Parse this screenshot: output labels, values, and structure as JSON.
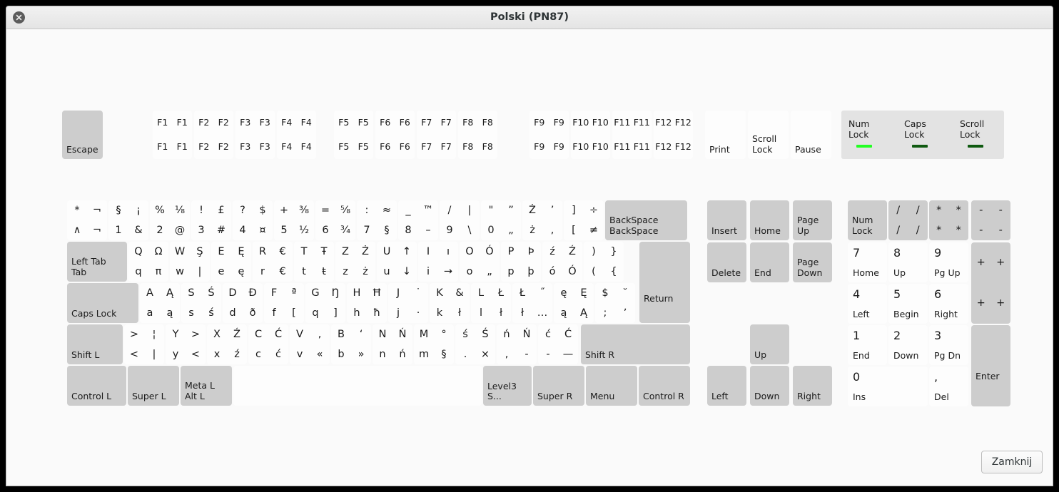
{
  "window": {
    "title": "Polski (PN87)",
    "close_icon": "close-icon"
  },
  "footer": {
    "close_label": "Zamknij"
  },
  "leds": {
    "items": [
      {
        "label": "Num\nLock",
        "line1": "Num",
        "line2": "Lock",
        "color": "#22ff22",
        "state": "on"
      },
      {
        "label": "Caps\nLock",
        "line1": "Caps",
        "line2": "Lock",
        "color": "#0f5a10",
        "state": "off"
      },
      {
        "label": "Scroll\nLock",
        "line1": "Scroll",
        "line2": "Lock",
        "color": "#0f5a10",
        "state": "off"
      }
    ]
  },
  "keys": {
    "escape": {
      "label": "Escape"
    },
    "function_row": [
      {
        "name": "F1",
        "q": [
          "F1",
          "F1",
          "F1",
          "F1"
        ]
      },
      {
        "name": "F2",
        "q": [
          "F2",
          "F2",
          "F2",
          "F2"
        ]
      },
      {
        "name": "F3",
        "q": [
          "F3",
          "F3",
          "F3",
          "F3"
        ]
      },
      {
        "name": "F4",
        "q": [
          "F4",
          "F4",
          "F4",
          "F4"
        ]
      },
      {
        "name": "F5",
        "q": [
          "F5",
          "F5",
          "F5",
          "F5"
        ]
      },
      {
        "name": "F6",
        "q": [
          "F6",
          "F6",
          "F6",
          "F6"
        ]
      },
      {
        "name": "F7",
        "q": [
          "F7",
          "F7",
          "F7",
          "F7"
        ]
      },
      {
        "name": "F8",
        "q": [
          "F8",
          "F8",
          "F8",
          "F8"
        ]
      },
      {
        "name": "F9",
        "q": [
          "F9",
          "F9",
          "F9",
          "F9"
        ]
      },
      {
        "name": "F10",
        "q": [
          "F10",
          "F10",
          "F10",
          "F10"
        ]
      },
      {
        "name": "F11",
        "q": [
          "F11",
          "F11",
          "F11",
          "F11"
        ]
      },
      {
        "name": "F12",
        "q": [
          "F12",
          "F12",
          "F12",
          "F12"
        ]
      }
    ],
    "sysreq": [
      {
        "name": "Print",
        "label": "Print"
      },
      {
        "name": "Scroll Lock",
        "line1": "Scroll",
        "line2": "Lock"
      },
      {
        "name": "Pause",
        "label": "Pause"
      }
    ],
    "row_number": [
      {
        "name": "grave",
        "q": [
          "*",
          "¬",
          "∧",
          "¬"
        ]
      },
      {
        "name": "1",
        "q": [
          "§",
          "¡",
          "1",
          "&"
        ]
      },
      {
        "name": "2",
        "q": [
          "%",
          "⅛",
          "2",
          "@"
        ]
      },
      {
        "name": "3",
        "q": [
          "!",
          "£",
          "3",
          "#"
        ]
      },
      {
        "name": "4",
        "q": [
          "?",
          "$",
          "4",
          "¤"
        ]
      },
      {
        "name": "5",
        "q": [
          "+",
          "⅜",
          "5",
          "½"
        ]
      },
      {
        "name": "6",
        "q": [
          "=",
          "⅝",
          "6",
          "¾"
        ]
      },
      {
        "name": "7",
        "q": [
          ":",
          "≈",
          "7",
          "§"
        ]
      },
      {
        "name": "8",
        "q": [
          "_",
          "™",
          "8",
          "–"
        ]
      },
      {
        "name": "9",
        "q": [
          "/",
          "|",
          "9",
          "\\"
        ]
      },
      {
        "name": "0",
        "q": [
          "\"",
          "”",
          "0",
          "„"
        ]
      },
      {
        "name": "minus",
        "q": [
          "Ż",
          "’",
          "ż",
          ","
        ]
      },
      {
        "name": "equal",
        "q": [
          "]",
          "÷",
          "[",
          "≠"
        ]
      }
    ],
    "backspace": {
      "line1": "BackSpace",
      "line2": "BackSpace"
    },
    "row_q": [
      {
        "name": "Tab",
        "line1": "Left Tab",
        "line2": "Tab"
      },
      {
        "name": "Q",
        "q": [
          "Q",
          "Ω",
          "q",
          "π"
        ]
      },
      {
        "name": "W",
        "q": [
          "W",
          "Ş",
          "w",
          "|"
        ]
      },
      {
        "name": "E",
        "q": [
          "E",
          "Ę",
          "e",
          "ę"
        ]
      },
      {
        "name": "R",
        "q": [
          "R",
          "€",
          "r",
          "€"
        ]
      },
      {
        "name": "T",
        "q": [
          "T",
          "Ŧ",
          "t",
          "ŧ"
        ]
      },
      {
        "name": "Z",
        "q": [
          "Z",
          "Ż",
          "z",
          "ż"
        ]
      },
      {
        "name": "U",
        "q": [
          "U",
          "↑",
          "u",
          "↓"
        ]
      },
      {
        "name": "I",
        "q": [
          "I",
          "ı",
          "i",
          "→"
        ]
      },
      {
        "name": "O",
        "q": [
          "O",
          "Ó",
          "o",
          "„"
        ]
      },
      {
        "name": "P",
        "q": [
          "P",
          "Þ",
          "p",
          "þ"
        ]
      },
      {
        "name": "bracketleft",
        "q": [
          "ź",
          "Ź",
          "ó",
          "Ó"
        ]
      },
      {
        "name": "bracketright",
        "q": [
          ")",
          "}",
          "(",
          "{"
        ]
      }
    ],
    "return": {
      "label": "Return"
    },
    "row_a": [
      {
        "name": "Caps Lock",
        "label": "Caps Lock"
      },
      {
        "name": "A",
        "q": [
          "A",
          "Ą",
          "a",
          "ą"
        ]
      },
      {
        "name": "S",
        "q": [
          "S",
          "Ś",
          "s",
          "ś"
        ]
      },
      {
        "name": "D",
        "q": [
          "D",
          "Đ",
          "d",
          "ð"
        ]
      },
      {
        "name": "F",
        "q": [
          "F",
          "ª",
          "f",
          "["
        ]
      },
      {
        "name": "G",
        "q": [
          "G",
          "Ŋ",
          "q",
          "]"
        ]
      },
      {
        "name": "H",
        "q": [
          "H",
          "Ħ",
          "h",
          "ħ"
        ]
      },
      {
        "name": "J",
        "q": [
          "J",
          "˙",
          "j",
          "·"
        ]
      },
      {
        "name": "K",
        "q": [
          "K",
          "&",
          "k",
          "ł"
        ]
      },
      {
        "name": "L",
        "q": [
          "L",
          "Ł",
          "l",
          "ł"
        ]
      },
      {
        "name": "semicolon",
        "q": [
          "Ł",
          "˝",
          "ł",
          "…"
        ]
      },
      {
        "name": "quote",
        "q": [
          "ę",
          "Ę",
          "ą",
          "Ą"
        ]
      },
      {
        "name": "backslash",
        "q": [
          "$",
          "˘",
          ";",
          "ʼ"
        ]
      }
    ],
    "row_z": [
      {
        "name": "Shift L",
        "label": "Shift L"
      },
      {
        "name": "less",
        "q": [
          ">",
          "¦",
          "<",
          "|"
        ]
      },
      {
        "name": "Y",
        "q": [
          "Y",
          ">",
          "y",
          "<"
        ]
      },
      {
        "name": "X",
        "q": [
          "X",
          "Ź",
          "x",
          "ź"
        ]
      },
      {
        "name": "C",
        "q": [
          "C",
          "Ć",
          "c",
          "ć"
        ]
      },
      {
        "name": "V",
        "q": [
          "V",
          ",",
          "v",
          "«"
        ]
      },
      {
        "name": "B",
        "q": [
          "B",
          "‘",
          "b",
          "»"
        ]
      },
      {
        "name": "N",
        "q": [
          "N",
          "Ń",
          "n",
          "ń"
        ]
      },
      {
        "name": "M",
        "q": [
          "M",
          "°",
          "m",
          "§"
        ]
      },
      {
        "name": "comma",
        "q": [
          "ś",
          "Ś",
          ".",
          "×"
        ]
      },
      {
        "name": "period",
        "q": [
          "ń",
          "Ń",
          ",",
          "-"
        ]
      },
      {
        "name": "slash",
        "q": [
          "ć",
          "Ć",
          "-",
          "—"
        ]
      }
    ],
    "shift_r": {
      "label": "Shift R"
    },
    "row_bottom": [
      {
        "name": "Control L",
        "label": "Control L"
      },
      {
        "name": "Super L",
        "label": "Super L"
      },
      {
        "name": "Alt L",
        "line1": "Meta L",
        "line2": "Alt L"
      },
      {
        "name": "space",
        "label": ""
      },
      {
        "name": "Level3 Shift",
        "label": "Level3 S..."
      },
      {
        "name": "Super R",
        "label": "Super R"
      },
      {
        "name": "Menu",
        "label": "Menu"
      },
      {
        "name": "Control R",
        "label": "Control R"
      }
    ],
    "nav": [
      {
        "name": "Insert",
        "label": "Insert"
      },
      {
        "name": "Home",
        "label": "Home"
      },
      {
        "name": "Page Up",
        "line1": "Page",
        "line2": "Up"
      },
      {
        "name": "Delete",
        "label": "Delete"
      },
      {
        "name": "End",
        "label": "End"
      },
      {
        "name": "Page Down",
        "line1": "Page",
        "line2": "Down"
      }
    ],
    "arrows": [
      {
        "name": "Up",
        "label": "Up"
      },
      {
        "name": "Left",
        "label": "Left"
      },
      {
        "name": "Down",
        "label": "Down"
      },
      {
        "name": "Right",
        "label": "Right"
      }
    ],
    "numpad": {
      "numlock": {
        "line1": "Num",
        "line2": "Lock"
      },
      "divide": {
        "q": [
          "/",
          "/",
          "/",
          "/"
        ]
      },
      "multiply": {
        "q": [
          "*",
          "*",
          "*",
          "*"
        ]
      },
      "subtract": {
        "q": [
          "-",
          "-",
          "-",
          "-"
        ]
      },
      "add": {
        "q": [
          "+",
          "+",
          "+",
          "+"
        ]
      },
      "enter": {
        "label": "Enter"
      },
      "digits": [
        {
          "name": "KP 7",
          "main": "7",
          "sub": "Home"
        },
        {
          "name": "KP 8",
          "main": "8",
          "sub": "Up"
        },
        {
          "name": "KP 9",
          "main": "9",
          "sub": "Pg Up"
        },
        {
          "name": "KP 4",
          "main": "4",
          "sub": "Left"
        },
        {
          "name": "KP 5",
          "main": "5",
          "sub": "Begin"
        },
        {
          "name": "KP 6",
          "main": "6",
          "sub": "Right"
        },
        {
          "name": "KP 1",
          "main": "1",
          "sub": "End"
        },
        {
          "name": "KP 2",
          "main": "2",
          "sub": "Down"
        },
        {
          "name": "KP 3",
          "main": "3",
          "sub": "Pg Dn"
        },
        {
          "name": "KP 0",
          "main": "0",
          "sub": "Ins"
        },
        {
          "name": "KP Decimal",
          "main": ",",
          "sub": "Del"
        }
      ]
    }
  }
}
